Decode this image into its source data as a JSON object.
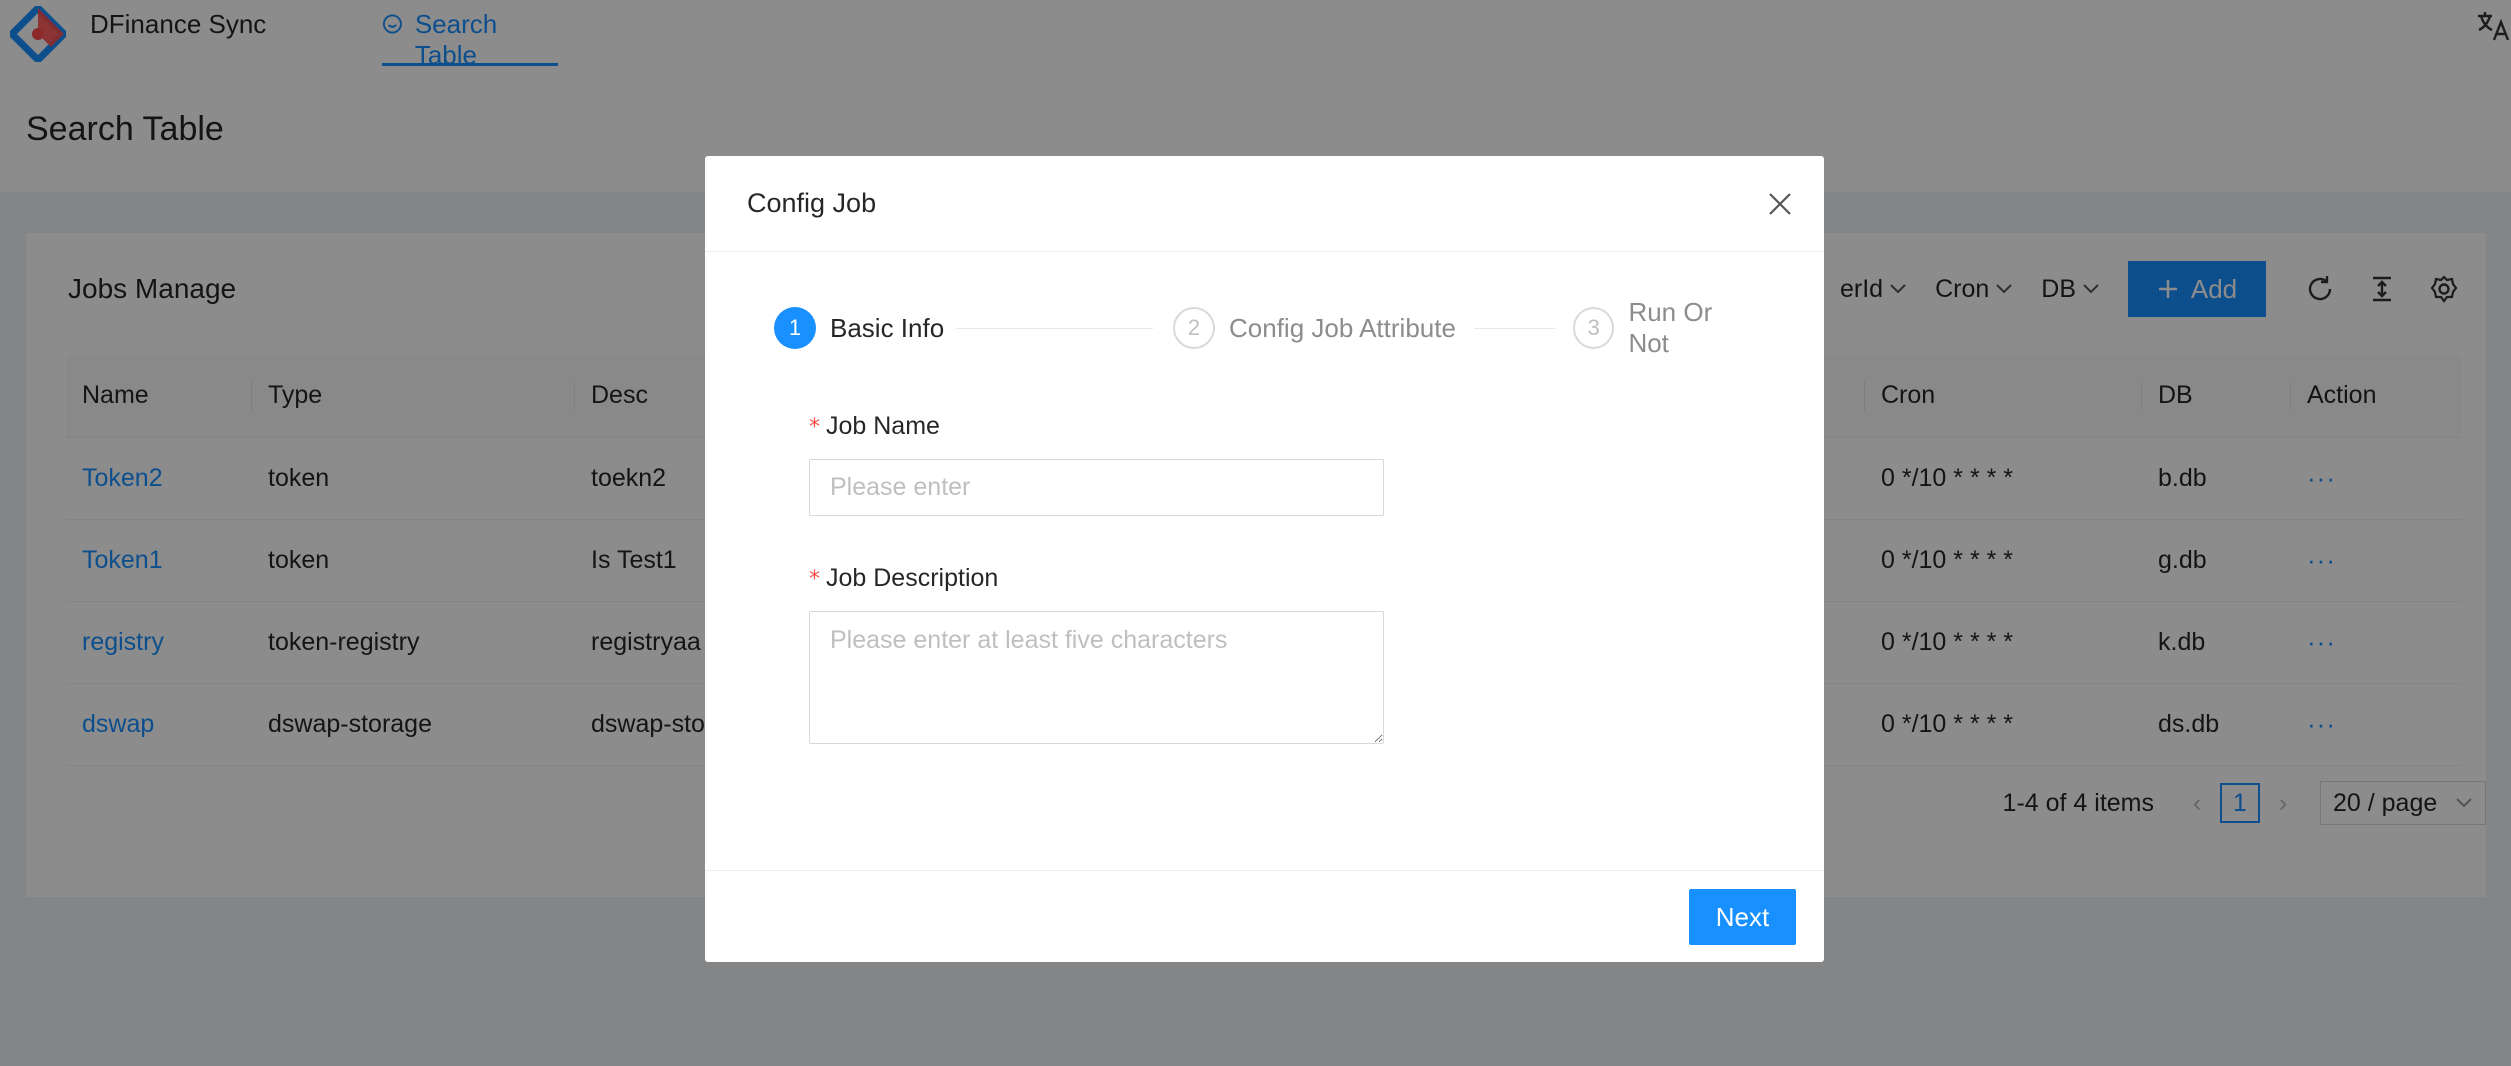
{
  "app": {
    "title": "DFinance Sync",
    "nav_tab": "Search Table",
    "accent_color": "#1890ff",
    "icons": {
      "logo": "diamond-logo",
      "nav": "smile-icon",
      "language": "translate-icon"
    }
  },
  "page": {
    "title": "Search Table"
  },
  "card": {
    "title": "Jobs Manage",
    "column_filters": [
      "erId",
      "Cron",
      "DB"
    ],
    "add_label": "Add",
    "toolbar_icons": [
      "reload-icon",
      "column-height-icon",
      "setting-icon"
    ]
  },
  "table": {
    "columns": [
      "Name",
      "Type",
      "Desc",
      "",
      "Cron",
      "DB",
      "Action"
    ],
    "rows": [
      {
        "name": "Token2",
        "type": "token",
        "desc": "toekn2",
        "cron": "0 */10 * * * *",
        "db": "b.db",
        "action": "···"
      },
      {
        "name": "Token1",
        "type": "token",
        "desc": "Is Test1",
        "cron": "0 */10 * * * *",
        "db": "g.db",
        "action": "···"
      },
      {
        "name": "registry",
        "type": "token-registry",
        "desc": "registryaa",
        "cron": "0 */10 * * * *",
        "db": "k.db",
        "action": "···"
      },
      {
        "name": "dswap",
        "type": "dswap-storage",
        "desc": "dswap-sto",
        "cron": "0 */10 * * * *",
        "db": "ds.db",
        "action": "···"
      }
    ]
  },
  "pagination": {
    "total": "1-4 of 4 items",
    "current_page": "1",
    "page_size": "20 / page"
  },
  "modal": {
    "title": "Config Job",
    "steps": [
      {
        "number": "1",
        "title": "Basic Info",
        "status": "active"
      },
      {
        "number": "2",
        "title": "Config Job Attribute",
        "status": "wait"
      },
      {
        "number": "3",
        "title": "Run Or Not",
        "status": "wait"
      }
    ],
    "fields": {
      "job_name": {
        "label": "Job Name",
        "value": "",
        "placeholder": "Please enter",
        "required_mark": "*"
      },
      "job_description": {
        "label": "Job Description",
        "value": "",
        "placeholder": "Please enter at least five characters",
        "required_mark": "*"
      }
    },
    "next_label": "Next"
  }
}
